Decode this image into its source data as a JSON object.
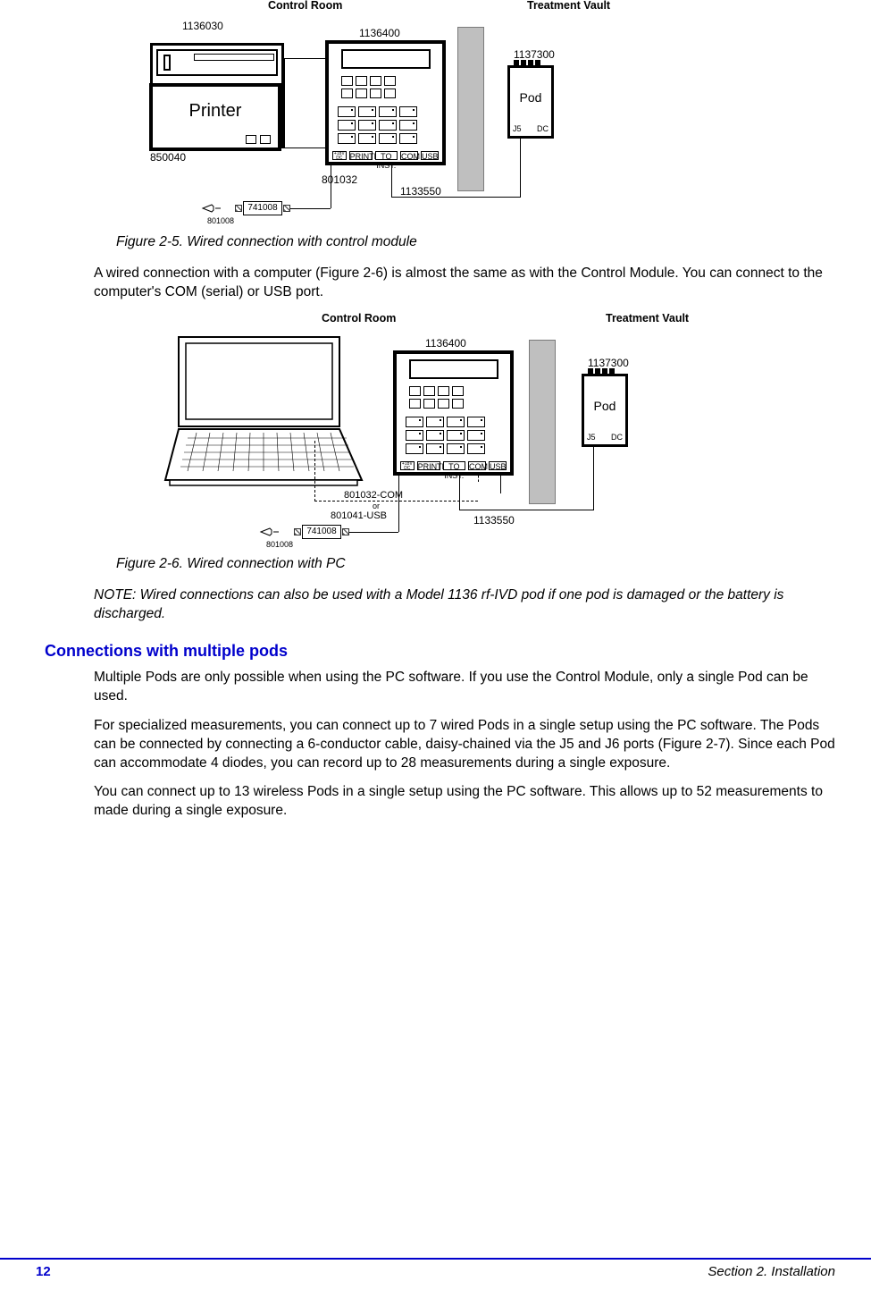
{
  "figure25": {
    "labels": {
      "control_room": "Control Room",
      "treatment_vault": "Treatment Vault",
      "printer": "Printer",
      "pod": "Pod"
    },
    "part_numbers": {
      "ctrl_left": "1136030",
      "ctrl_printer": "850040",
      "module": "1136400",
      "sub_module": "801032",
      "cable_a": "741008",
      "cable_a_sub": "801008",
      "long_cable": "1133550",
      "pod": "1137300"
    },
    "port_labels": {
      "dc": "+18V DC",
      "printer": "PRINTER",
      "toinst": "TO INST.",
      "com": "COM",
      "usb": "USB",
      "j5": "J5",
      "pod_dc": "DC"
    },
    "caption": "Figure 2-5. Wired connection with control module"
  },
  "body1": "A wired connection with a computer (Figure 2-6) is almost the same as with the Control Module. You can connect to the computer's COM (serial) or USB port.",
  "figure26": {
    "labels": {
      "control_room": "Control Room",
      "treatment_vault": "Treatment Vault",
      "pod": "Pod",
      "or": "or"
    },
    "part_numbers": {
      "module": "1136400",
      "com_cable": "801032-COM",
      "usb_cable": "801041-USB",
      "cable_a": "741008",
      "cable_a_sub": "801008",
      "long_cable": "1133550",
      "pod": "1137300"
    },
    "port_labels": {
      "dc": "+18V DC",
      "printer": "PRINTER",
      "toinst": "TO INST.",
      "com": "COM",
      "usb": "USB",
      "j5": "J5",
      "pod_dc": "DC"
    },
    "caption": "Figure 2-6. Wired connection with PC"
  },
  "note": "NOTE: Wired connections can also be used with a Model 1136 rf-IVD pod if one pod is damaged or the battery is discharged.",
  "section_heading": "Connections with multiple pods",
  "body2": "Multiple Pods are only possible when using the PC software. If you use the Control Module, only a single Pod can be used.",
  "body3": "For specialized measurements, you can connect up to 7 wired Pods in a single setup using the PC software. The Pods can be connected by connecting a 6-conductor cable, daisy-chained via the J5 and J6 ports (Figure 2-7). Since each Pod can accommodate 4 diodes, you can record up to 28 measurements during a single exposure.",
  "body4": "You can connect up to 13 wireless Pods in a single setup using the PC software. This allows up to 52 measurements to made during a single exposure.",
  "footer": {
    "page": "12",
    "section": "Section 2. Installation"
  }
}
